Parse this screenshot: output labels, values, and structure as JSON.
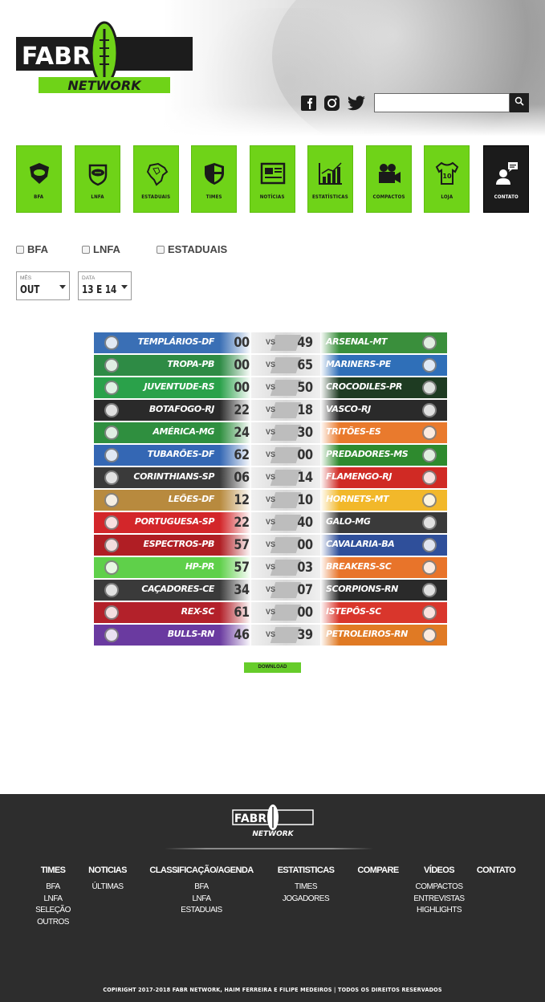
{
  "brand": {
    "logo_top": "FABR",
    "logo_bottom": "NETWORK",
    "accent": "#6fd318"
  },
  "header": {
    "social": [
      {
        "icon": "facebook-icon"
      },
      {
        "icon": "instagram-icon"
      },
      {
        "icon": "twitter-icon"
      }
    ],
    "search": {
      "placeholder": "",
      "icon": "search-icon"
    }
  },
  "nav": [
    {
      "label": "BFA",
      "icon": "bfa-shield-icon"
    },
    {
      "label": "LNFA",
      "icon": "lnfa-football-icon"
    },
    {
      "label": "ESTADUAIS",
      "icon": "brazil-map-icon"
    },
    {
      "label": "TIMES",
      "icon": "team-shield-icon"
    },
    {
      "label": "NOTÍCIAS",
      "icon": "newspaper-icon"
    },
    {
      "label": "ESTATÍSTICAS",
      "icon": "bar-chart-icon"
    },
    {
      "label": "COMPACTOS",
      "icon": "video-camera-icon"
    },
    {
      "label": "LOJA",
      "icon": "jersey-icon"
    },
    {
      "label": "CONTATO",
      "icon": "contact-icon"
    }
  ],
  "filters": {
    "leagues": [
      "BFA",
      "LNFA",
      "ESTADUAIS"
    ],
    "month": {
      "caption": "MÊS",
      "value": "OUT"
    },
    "date": {
      "caption": "DATA",
      "value": "13 E 14"
    }
  },
  "results": [
    {
      "home": "TEMPLÁRIOS-DF",
      "home_score": "00",
      "away_score": "49",
      "away": "ARSENAL-MT",
      "home_color": "#3a6fb5",
      "away_color": "#3a8f3c"
    },
    {
      "home": "TROPA-PB",
      "home_score": "00",
      "away_score": "65",
      "away": "MARINERS-PE",
      "home_color": "#2e8b45",
      "away_color": "#2f6fb8"
    },
    {
      "home": "JUVENTUDE-RS",
      "home_score": "00",
      "away_score": "50",
      "away": "CROCODILES-PR",
      "home_color": "#2aa14a",
      "away_color": "#1e3b22"
    },
    {
      "home": "BOTAFOGO-RJ",
      "home_score": "22",
      "away_score": "18",
      "away": "VASCO-RJ",
      "home_color": "#2a2a2a",
      "away_color": "#2a2a2a"
    },
    {
      "home": "AMÉRICA-MG",
      "home_score": "24",
      "away_score": "30",
      "away": "TRITÕES-ES",
      "home_color": "#2f8f3f",
      "away_color": "#e97a2d"
    },
    {
      "home": "TUBARÕES-DF",
      "home_score": "62",
      "away_score": "00",
      "away": "PREDADORES-MS",
      "home_color": "#3467b4",
      "away_color": "#2e8a2e"
    },
    {
      "home": "CORINTHIANS-SP",
      "home_score": "06",
      "away_score": "14",
      "away": "FLAMENGO-RJ",
      "home_color": "#3a3a3a",
      "away_color": "#d02a24"
    },
    {
      "home": "LEÕES-DF",
      "home_score": "12",
      "away_score": "10",
      "away": "HORNETS-MT",
      "home_color": "#b88a3e",
      "away_color": "#f2b82a"
    },
    {
      "home": "PORTUGUESA-SP",
      "home_score": "22",
      "away_score": "40",
      "away": "GALO-MG",
      "home_color": "#d3262a",
      "away_color": "#3a3a3a"
    },
    {
      "home": "ESPECTROS-PB",
      "home_score": "57",
      "away_score": "00",
      "away": "CAVALARIA-BA",
      "home_color": "#b01e24",
      "away_color": "#2f4f9a"
    },
    {
      "home": "HP-PR",
      "home_score": "57",
      "away_score": "03",
      "away": "BREAKERS-SC",
      "home_color": "#5fd04a",
      "away_color": "#e8742a"
    },
    {
      "home": "CAÇADORES-CE",
      "home_score": "34",
      "away_score": "07",
      "away": "SCORPIONS-RN",
      "home_color": "#3a3a3a",
      "away_color": "#2a2a2a"
    },
    {
      "home": "REX-SC",
      "home_score": "61",
      "away_score": "00",
      "away": "ISTEPÔS-SC",
      "home_color": "#b3212a",
      "away_color": "#d9362c"
    },
    {
      "home": "BULLS-RN",
      "home_score": "46",
      "away_score": "39",
      "away": "PETROLEIROS-RN",
      "home_color": "#6a3aa0",
      "away_color": "#e07a24"
    }
  ],
  "vs_label": "VS",
  "download_label": "DOWNLOAD",
  "footer": {
    "columns": [
      {
        "title": "TIMES",
        "items": [
          "BFA",
          "LNFA",
          "SELEÇÃO",
          "OUTROS"
        ]
      },
      {
        "title": "NOTICIAS",
        "items": [
          "ÚLTIMAS"
        ]
      },
      {
        "title": "CLASSIFICAÇÃO/AGENDA",
        "items": [
          "BFA",
          "LNFA",
          "ESTADUAIS"
        ]
      },
      {
        "title": "ESTATISTICAS",
        "items": [
          "TIMES",
          "JOGADORES"
        ]
      },
      {
        "title": "COMPARE",
        "items": []
      },
      {
        "title": "VÍDEOS",
        "items": [
          "COMPACTOS",
          "ENTREVISTAS",
          "HIGHLIGHTS"
        ]
      },
      {
        "title": "CONTATO",
        "items": []
      }
    ],
    "copyright": "COPIRIGHT 2017-2018 FABR NETWORK, HAIM FERREIRA E FILIPE MEDEIROS | TODOS OS DIREITOS RESERVADOS"
  }
}
